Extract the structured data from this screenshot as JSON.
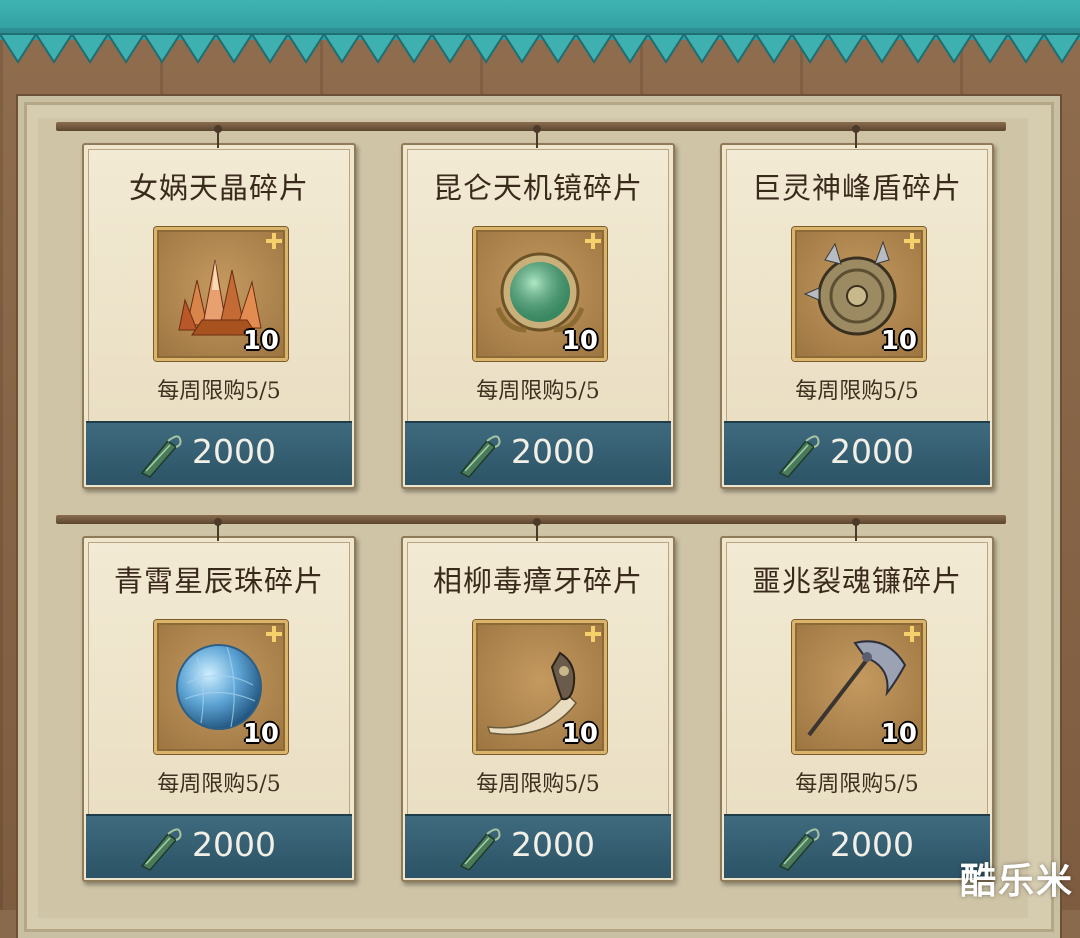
{
  "shop": {
    "items": [
      {
        "name": "女娲天晶碎片",
        "count": "10",
        "limit": "每周限购5/5",
        "price": "2000",
        "icon": "crystal-cluster-icon"
      },
      {
        "name": "昆仑天机镜碎片",
        "count": "10",
        "limit": "每周限购5/5",
        "price": "2000",
        "icon": "jade-mirror-icon"
      },
      {
        "name": "巨灵神峰盾碎片",
        "count": "10",
        "limit": "每周限购5/5",
        "price": "2000",
        "icon": "bronze-shield-icon"
      },
      {
        "name": "青霄星辰珠碎片",
        "count": "10",
        "limit": "每周限购5/5",
        "price": "2000",
        "icon": "blue-orb-icon"
      },
      {
        "name": "相柳毒瘴牙碎片",
        "count": "10",
        "limit": "每周限购5/5",
        "price": "2000",
        "icon": "venom-fang-icon"
      },
      {
        "name": "噩兆裂魂镰碎片",
        "count": "10",
        "limit": "每周限购5/5",
        "price": "2000",
        "icon": "scythe-icon"
      }
    ]
  },
  "watermark": "酷乐米",
  "colors": {
    "bunting": "#3fb3b3",
    "price_bar": "#2c5366",
    "card_bg": "#f2ead4",
    "frame_gold": "#d9b46a"
  }
}
